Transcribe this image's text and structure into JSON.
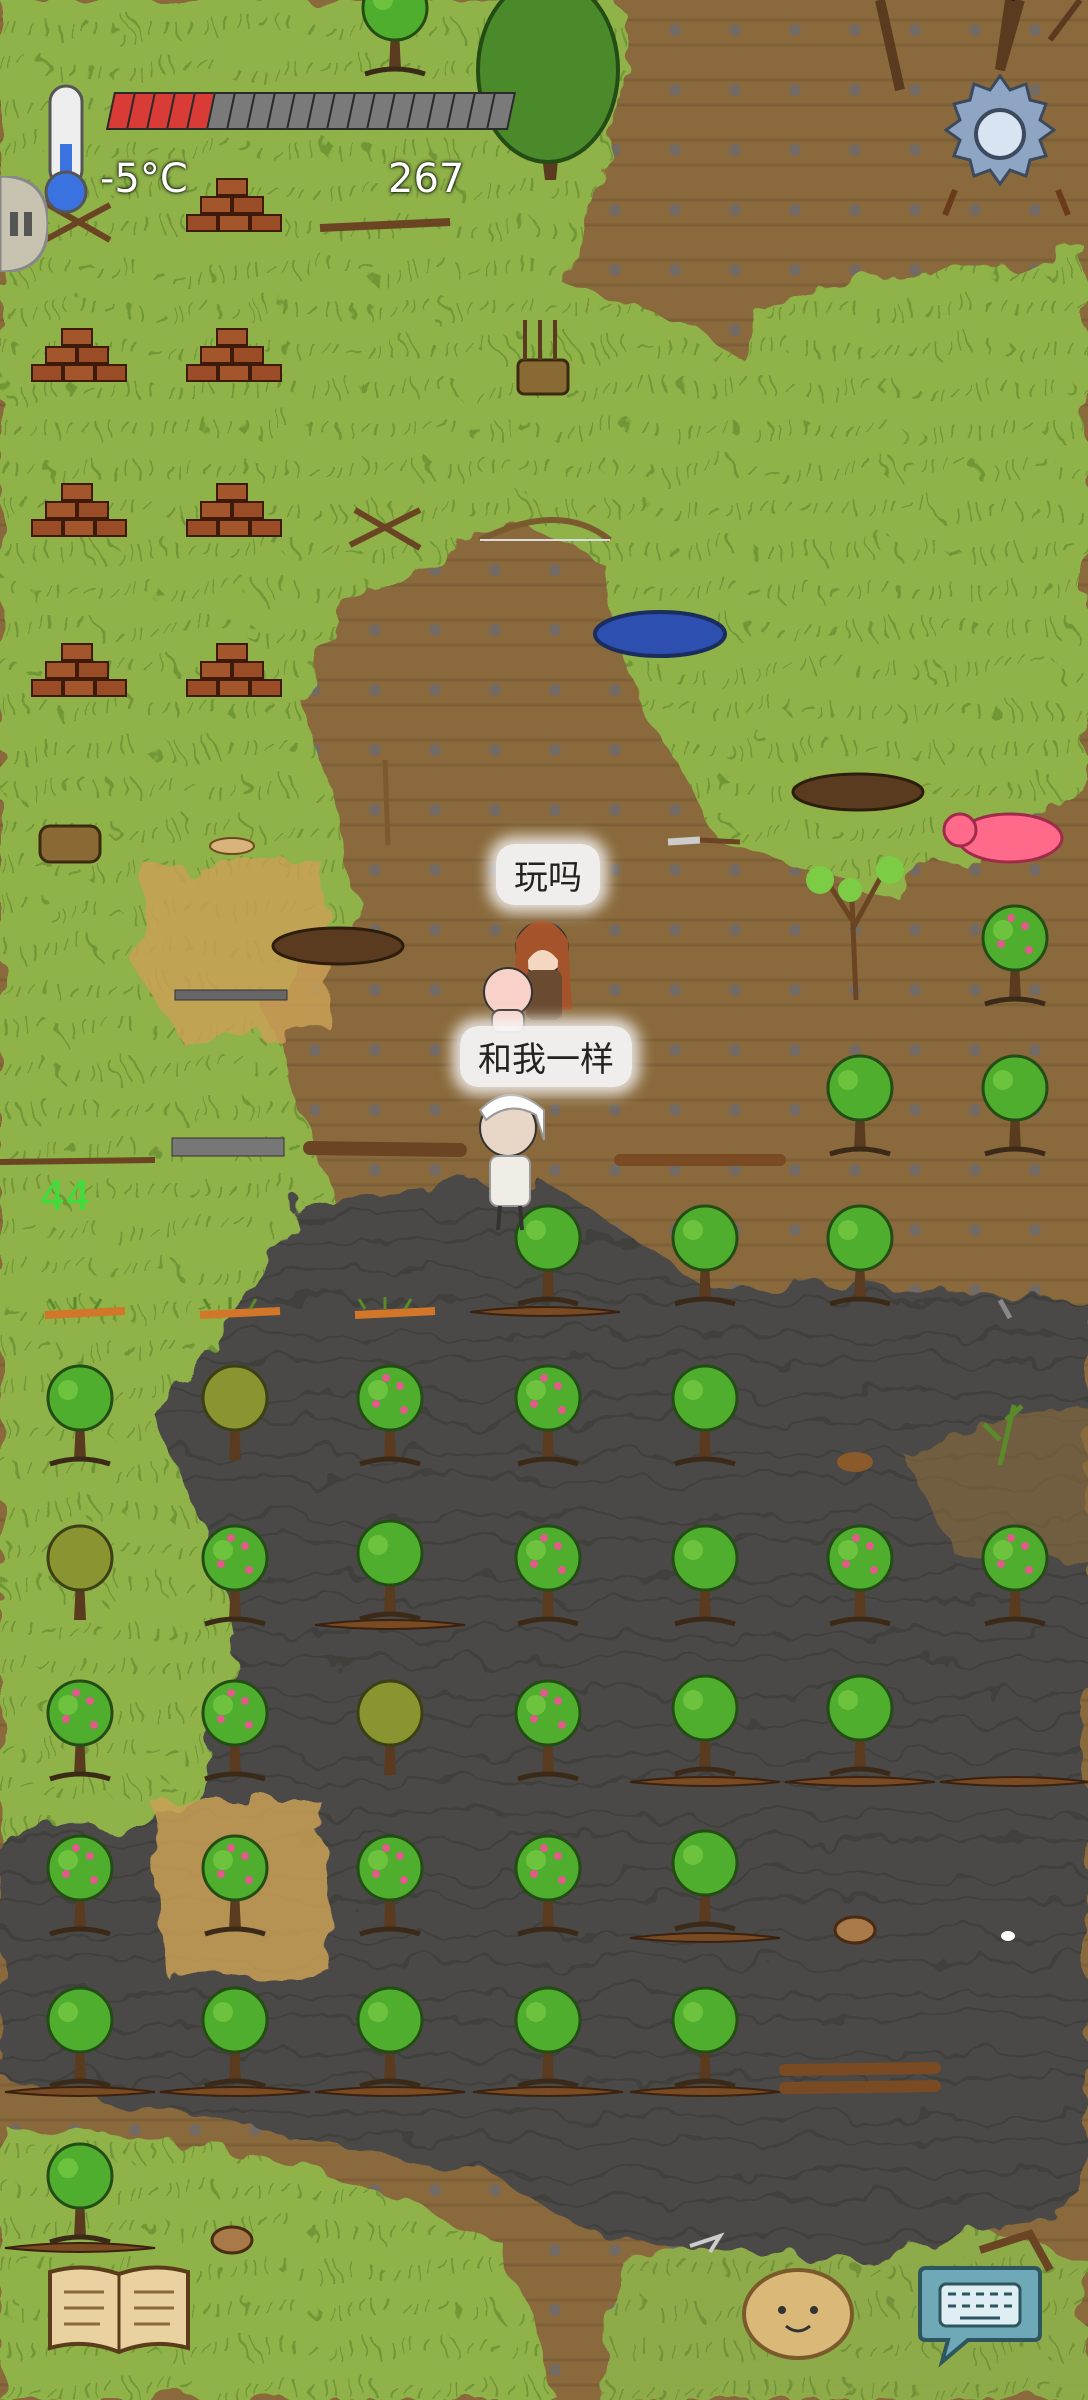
{
  "hud": {
    "temperature": "-5°C",
    "count": "267",
    "food_filled": 5,
    "food_total": 20,
    "age_indicator": "44"
  },
  "speech": {
    "top": "玩吗",
    "bottom": "和我一样"
  },
  "icons": {
    "thermometer": "thermometer-icon",
    "settings": "gear-icon",
    "tech_book": "book-icon",
    "emote": "potato-face-icon",
    "chat": "keyboard-icon",
    "side": "pause-icon"
  },
  "colors": {
    "grass": "#8fb24a",
    "dirt": "#8a6a3c",
    "swamp": "#4a4a48",
    "food_fill": "#d93b36",
    "food_empty": "#7a7a7a",
    "age_text": "#39e039"
  }
}
